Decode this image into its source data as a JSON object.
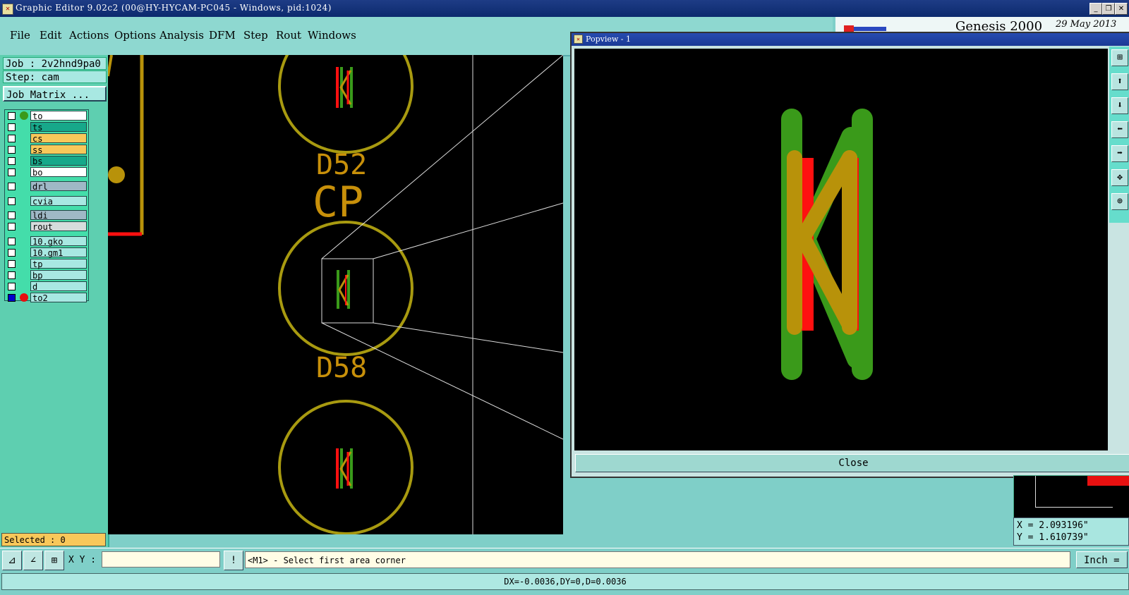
{
  "window": {
    "title": "Graphic Editor 9.02c2 (00@HY-HYCAM-PC045 - Windows, pid:1024)",
    "buttons": [
      "_",
      "❐",
      "✕"
    ]
  },
  "menu": [
    "File",
    "Edit",
    "Actions",
    "Options",
    "Analysis",
    "DFM",
    "Step",
    "Rout",
    "Windows"
  ],
  "brand": {
    "name": "Genesis 2000",
    "date": "29 May 2013"
  },
  "job": {
    "job_label": "Job : 2v2hnd9pa0",
    "step_label": "Step: cam",
    "matrix_button": "Job Matrix ..."
  },
  "layers": [
    {
      "name": "to",
      "bg": "#ffffff",
      "dot": "#3a9a1a",
      "checked": false
    },
    {
      "name": "ts",
      "bg": "#17a88a",
      "dot": "",
      "checked": false
    },
    {
      "name": "cs",
      "bg": "#f8c85a",
      "dot": "",
      "checked": false
    },
    {
      "name": "ss",
      "bg": "#f8c85a",
      "dot": "",
      "checked": false
    },
    {
      "name": "bs",
      "bg": "#17a88a",
      "dot": "",
      "checked": false
    },
    {
      "name": "bo",
      "bg": "#ffffff",
      "dot": "",
      "checked": false
    },
    {
      "name": "drl",
      "bg": "#9fb8c6",
      "dot": "",
      "checked": false
    },
    {
      "name": "cvia",
      "bg": "#a8e8e2",
      "dot": "",
      "checked": false
    },
    {
      "name": "ldi",
      "bg": "#9fb8c6",
      "dot": "",
      "checked": false
    },
    {
      "name": "rout",
      "bg": "#d6dcdc",
      "dot": "",
      "checked": false
    },
    {
      "name": "10.gko",
      "bg": "#a8e8e2",
      "dot": "",
      "checked": false
    },
    {
      "name": "10.gm1",
      "bg": "#a8e8e2",
      "dot": "",
      "checked": false
    },
    {
      "name": "tp",
      "bg": "#a8e8e2",
      "dot": "",
      "checked": false
    },
    {
      "name": "bp",
      "bg": "#a8e8e2",
      "dot": "",
      "checked": false
    },
    {
      "name": "d",
      "bg": "#a8e8e2",
      "dot": "",
      "checked": false
    },
    {
      "name": "to2",
      "bg": "#a8e8e2",
      "dot": "#e61010",
      "checked": true
    }
  ],
  "selected_label": "Selected : 0",
  "canvas_labels": {
    "ref1": "D52",
    "ref2": "CP",
    "ref3": "D58"
  },
  "popview": {
    "title": "Popview - 1",
    "close_label": "Close"
  },
  "coords": {
    "x": "X = 2.093196\"",
    "y": "Y = 1.610739\""
  },
  "cmd": {
    "xy_label": "X Y :",
    "xy_value": "",
    "prompt": "<M1> - Select first area corner",
    "unit": "Inch ="
  },
  "status": "DX=-0.0036,DY=0,D=0.0036",
  "colors": {
    "pad_green": "#3a9a1a",
    "silk_gold": "#b8920a",
    "trace_red": "#ff1010",
    "circle": "#a89a10"
  }
}
